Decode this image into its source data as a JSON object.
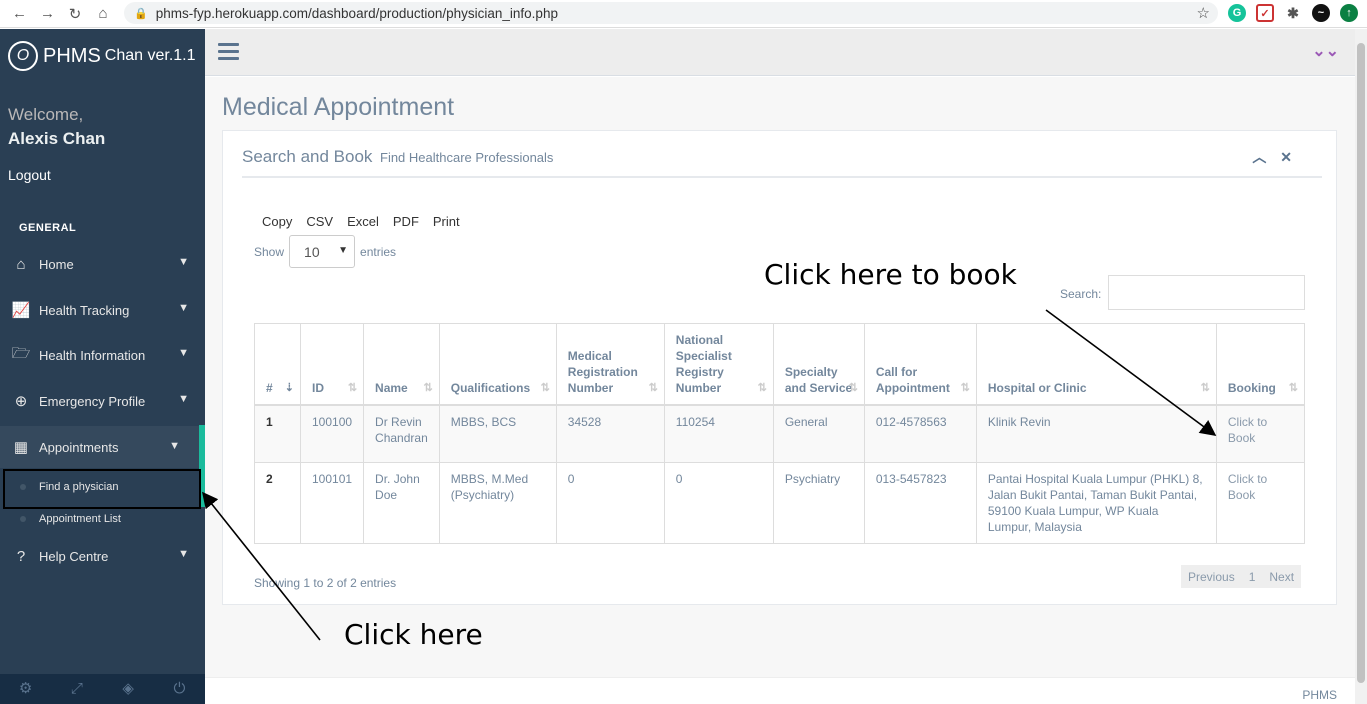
{
  "browser": {
    "url": "phms-fyp.herokuapp.com/dashboard/production/physician_info.php",
    "nav_icons": [
      "back-icon",
      "forward-icon",
      "reload-icon",
      "home-icon"
    ]
  },
  "sidebar": {
    "brand": "PHMS",
    "brand_suffix": "Chan ver.1.1",
    "welcome": "Welcome,",
    "user": "Alexis Chan",
    "logout": "Logout",
    "section": "GENERAL",
    "items": [
      {
        "label": "Home",
        "icon": "home-icon"
      },
      {
        "label": "Health Tracking",
        "icon": "chart-line-icon"
      },
      {
        "label": "Health Information",
        "icon": "folder-open-icon"
      },
      {
        "label": "Emergency Profile",
        "icon": "plus-circle-icon"
      },
      {
        "label": "Appointments",
        "icon": "calendar-icon"
      },
      {
        "label": "Help Centre",
        "icon": "question-circle-icon"
      }
    ],
    "sub_items": [
      {
        "label": "Find a physician"
      },
      {
        "label": "Appointment List"
      }
    ],
    "footer_icons": [
      "settings-icon",
      "fullscreen-icon",
      "lock-icon",
      "power-icon"
    ]
  },
  "page": {
    "title": "Medical Appointment"
  },
  "panel": {
    "title": "Search and Book",
    "subtitle": "Find Healthcare Professionals",
    "buttons": [
      "Copy",
      "CSV",
      "Excel",
      "PDF",
      "Print"
    ],
    "show_label": "Show",
    "entries_value": "10",
    "entries_label": "entries",
    "search_label": "Search:"
  },
  "table": {
    "headers": [
      "#",
      "ID",
      "Name",
      "Qualifications",
      "Medical Registration Number",
      "National Specialist Registry Number",
      "Specialty and Service",
      "Call for Appointment",
      "Hospital or Clinic",
      "Booking"
    ],
    "rows": [
      {
        "num": "1",
        "id": "100100",
        "name": "Dr Revin Chandran",
        "qualifications": "MBBS, BCS",
        "mrn": "34528",
        "nsr": "110254",
        "specialty": "General",
        "call": "012-4578563",
        "hospital": "Klinik Revin",
        "booking": "Click to Book"
      },
      {
        "num": "2",
        "id": "100101",
        "name": "Dr. John Doe",
        "qualifications": "MBBS, M.Med (Psychiatry)",
        "mrn": "0",
        "nsr": "0",
        "specialty": "Psychiatry",
        "call": "013-5457823",
        "hospital": "Pantai Hospital Kuala Lumpur (PHKL) 8, Jalan Bukit Pantai, Taman Bukit Pantai, 59100 Kuala Lumpur, WP Kuala Lumpur, Malaysia",
        "booking": "Click to Book"
      }
    ],
    "info": "Showing 1 to 2 of 2 entries",
    "pagination": [
      "Previous",
      "1",
      "Next"
    ]
  },
  "footer": {
    "text": "PHMS"
  },
  "annotations": {
    "book": "Click here to book",
    "find": "Click here"
  },
  "colors": {
    "sidebar": "#2A3F54",
    "accent": "#1ABB9C",
    "text": "#73879C"
  }
}
